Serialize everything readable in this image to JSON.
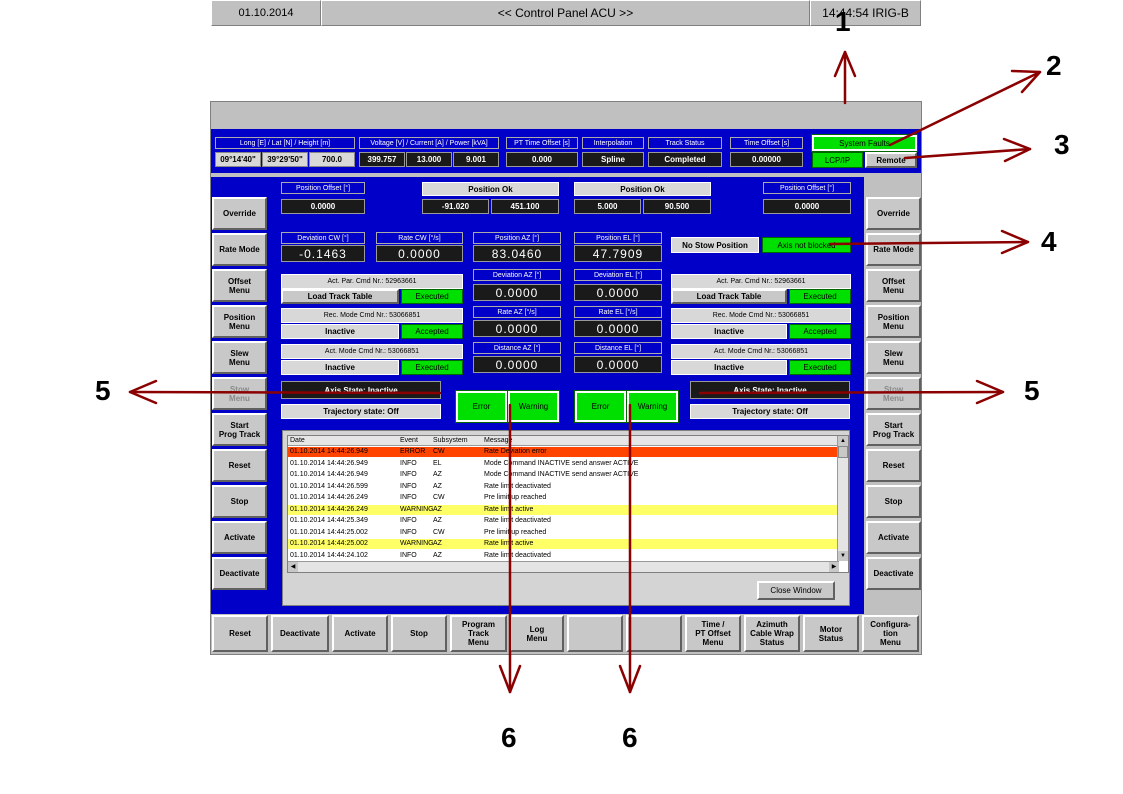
{
  "titlebar": {
    "date": "01.10.2014",
    "title": "<< Control Panel ACU >>",
    "time": "14:44:54 IRIG-B"
  },
  "info": {
    "geo_label": "Long [E]   /    Lat [N]    /    Height [m]",
    "long": "09°14'40\"",
    "lat": "39°29'50\"",
    "height": "700.0",
    "power_label": "Voltage [V]  / Current [A]  /  Power [kVA]",
    "voltage": "399.757",
    "current": "13.000",
    "power": "9.001",
    "pt_label": "PT Time Offset [s]",
    "pt_value": "0.000",
    "interp_label": "Interpolation",
    "interp_value": "Spline",
    "track_label": "Track Status",
    "track_value": "Completed",
    "toff_label": "Time Offset [s]",
    "toff_value": "0.00000",
    "system_faults": "System Faults",
    "lcp": "LCP/IP",
    "remote": "Remote"
  },
  "left": {
    "pos_offset_label": "Position Offset [°]",
    "pos_offset": "0.0000",
    "dev_label": "Deviation CW [°]",
    "dev": "-0.1463",
    "rate_label": "Rate  CW [°/s]",
    "rate": "0.0000",
    "act_par": "Act. Par. Cmd Nr.: 52963661",
    "load_track": "Load Track Table",
    "executed1": "Executed",
    "rec_mode": "Rec. Mode Cmd Nr.: 53066851",
    "inactive1": "Inactive",
    "accepted": "Accepted",
    "act_mode": "Act. Mode Cmd Nr.: 53066851",
    "inactive2": "Inactive",
    "executed2": "Executed",
    "axis_state": "Axis State: Inactive",
    "traj": "Trajectory state:  Off"
  },
  "center": {
    "pos_ok_az": "Position Ok",
    "az_v1": "-91.020",
    "az_v2": "451.100",
    "pos_az_label": "Position AZ [°]",
    "pos_az": "83.0460",
    "dev_az_label": "Deviation AZ [°]",
    "dev_az": "0.0000",
    "rate_az_label": "Rate  AZ [°/s]",
    "rate_az": "0.0000",
    "dist_az_label": "Distance AZ [°]",
    "dist_az": "0.0000",
    "pos_ok_el": "Position Ok",
    "el_v1": "5.000",
    "el_v2": "90.500",
    "pos_el_label": "Position EL [°]",
    "pos_el": "47.7909",
    "dev_el_label": "Deviation EL [°]",
    "dev_el": "0.0000",
    "rate_el_label": "Rate  EL [°/s]",
    "rate_el": "0.0000",
    "dist_el_label": "Distance EL [°]",
    "dist_el": "0.0000",
    "error": "Error",
    "warning": "Warning"
  },
  "right": {
    "pos_offset_label": "Position Offset [°]",
    "pos_offset": "0.0000",
    "no_stow": "No Stow Position",
    "axis_not_blocked": "Axis not blocked",
    "act_par": "Act. Par. Cmd Nr.: 52963661",
    "load_track": "Load Track Table",
    "executed1": "Executed",
    "rec_mode": "Rec. Mode Cmd Nr.: 53066851",
    "inactive1": "Inactive",
    "accepted": "Accepted",
    "act_mode": "Act. Mode Cmd Nr.: 53066851",
    "inactive2": "Inactive",
    "executed2": "Executed",
    "axis_state": "Axis State: Inactive",
    "traj": "Trajectory state:  Off"
  },
  "side_buttons": [
    "Override",
    "Rate Mode",
    "Offset\nMenu",
    "Position\nMenu",
    "Slew\nMenu",
    "Stow\nMenu",
    "Start\nProg Track",
    "Reset",
    "Stop",
    "Activate",
    "Deactivate"
  ],
  "bottom_buttons": [
    "Reset",
    "Deactivate",
    "Activate",
    "Stop",
    "Program\nTrack\nMenu",
    "Log\nMenu",
    "",
    "",
    "Time /\nPT Offset\nMenu",
    "Azimuth\nCable Wrap\nStatus",
    "Motor\nStatus",
    "Configura-\ntion\nMenu"
  ],
  "log": {
    "headers": [
      "Date",
      "Event",
      "Subsystem",
      "Message"
    ],
    "rows": [
      {
        "date": "01.10.2014  14:44:26.949",
        "event": "ERROR",
        "sub": "CW",
        "msg": "Rate Deviation error",
        "level": "error"
      },
      {
        "date": "01.10.2014  14:44:26.949",
        "event": "INFO",
        "sub": "EL",
        "msg": "Mode Command INACTIVE send answer ACTIVE",
        "level": "info"
      },
      {
        "date": "01.10.2014  14:44:26.949",
        "event": "INFO",
        "sub": "AZ",
        "msg": "Mode Command INACTIVE send answer ACTIVE",
        "level": "info"
      },
      {
        "date": "01.10.2014  14:44:26.599",
        "event": "INFO",
        "sub": "AZ",
        "msg": "Rate limit deactivated",
        "level": "info"
      },
      {
        "date": "01.10.2014  14:44:26.249",
        "event": "INFO",
        "sub": "CW",
        "msg": "Pre limit up reached",
        "level": "info"
      },
      {
        "date": "01.10.2014  14:44:26.249",
        "event": "WARNING",
        "sub": "AZ",
        "msg": "Rate limit active",
        "level": "warning"
      },
      {
        "date": "01.10.2014  14:44:25.349",
        "event": "INFO",
        "sub": "AZ",
        "msg": "Rate limit deactivated",
        "level": "info"
      },
      {
        "date": "01.10.2014  14:44:25.002",
        "event": "INFO",
        "sub": "CW",
        "msg": "Pre limit up reached",
        "level": "info"
      },
      {
        "date": "01.10.2014  14:44:25.002",
        "event": "WARNING",
        "sub": "AZ",
        "msg": "Rate limit active",
        "level": "warning"
      },
      {
        "date": "01.10.2014  14:44:24.102",
        "event": "INFO",
        "sub": "AZ",
        "msg": "Rate limit deactivated",
        "level": "info"
      }
    ],
    "close": "Close Window"
  },
  "callouts": [
    "1",
    "2",
    "3",
    "4",
    "5",
    "5",
    "6",
    "6"
  ]
}
